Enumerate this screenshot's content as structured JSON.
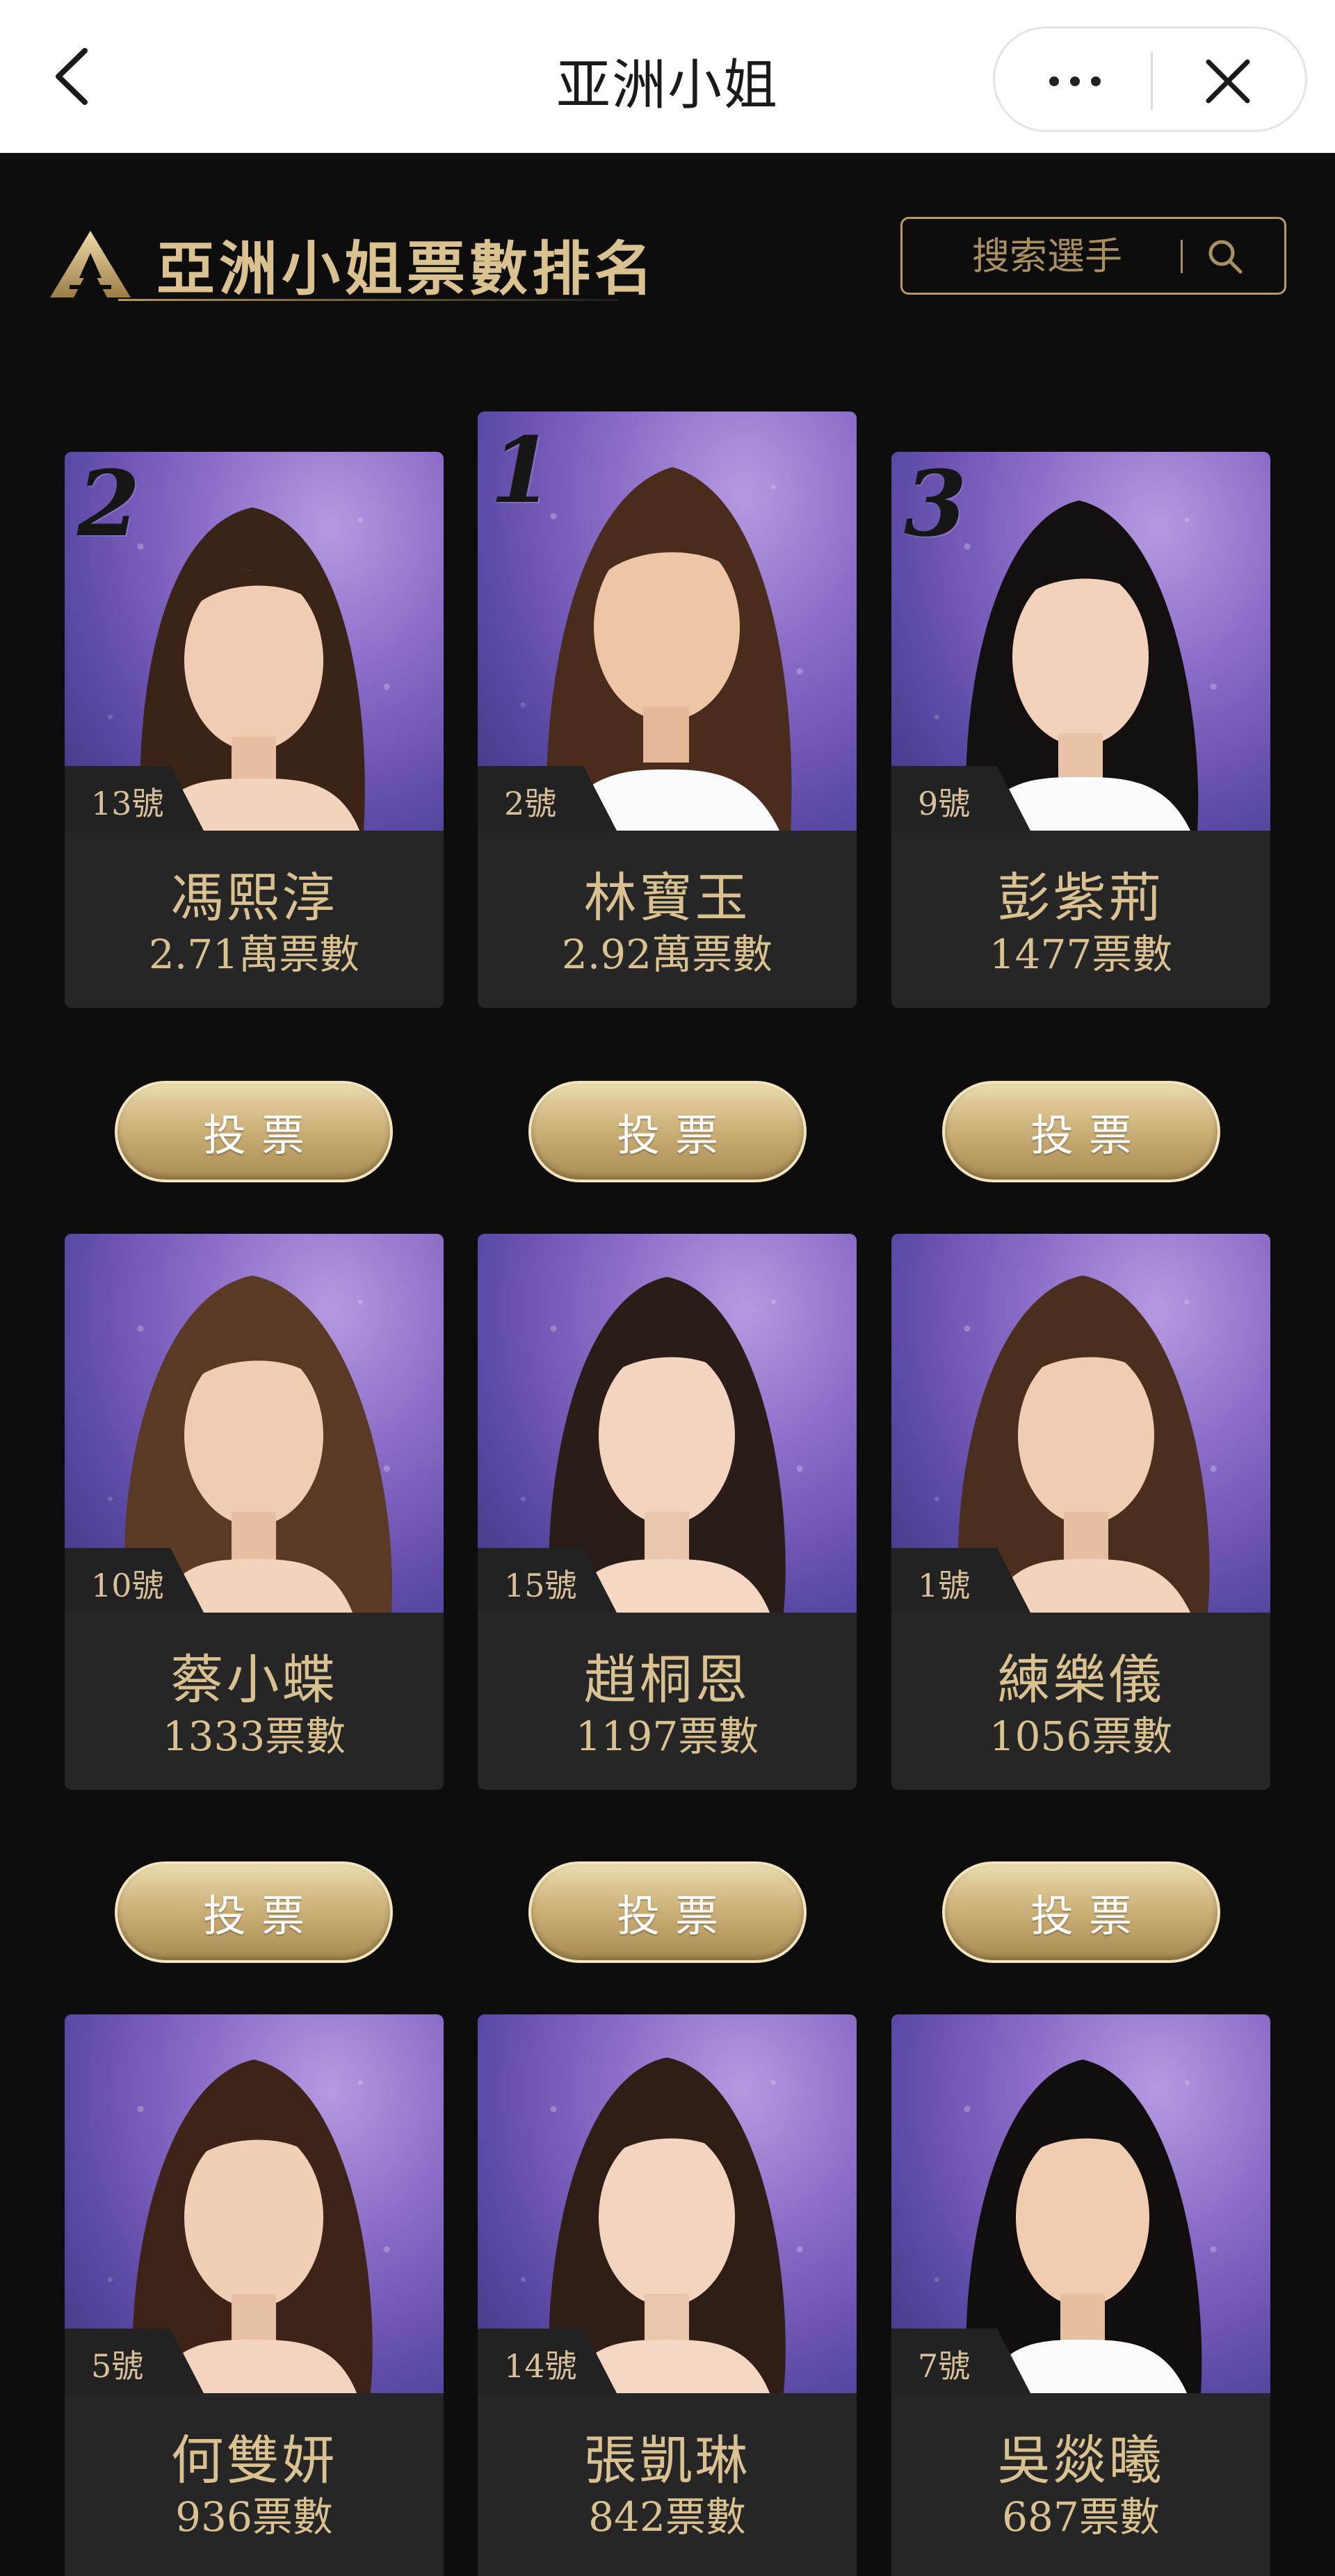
{
  "nav": {
    "title": "亚洲小姐"
  },
  "header": {
    "title": "亞洲小姐票數排名",
    "search_placeholder": "搜索選手"
  },
  "vote_label": "投票",
  "colors": {
    "gold": "#d9c190",
    "background": "#0d0d0d",
    "card": "#262626"
  },
  "contestants": [
    {
      "rank": "2",
      "number": "13號",
      "name": "馮熙淳",
      "votes": "2.71萬票數",
      "hair": "#3a2418"
    },
    {
      "rank": "1",
      "number": "2號",
      "name": "林寶玉",
      "votes": "2.92萬票數",
      "hair": "#4a2c1c"
    },
    {
      "rank": "3",
      "number": "9號",
      "name": "彭紫荊",
      "votes": "1477票數",
      "hair": "#141010"
    },
    {
      "rank": "",
      "number": "10號",
      "name": "蔡小蝶",
      "votes": "1333票數",
      "hair": "#5a3a24"
    },
    {
      "rank": "",
      "number": "15號",
      "name": "趙桐恩",
      "votes": "1197票數",
      "hair": "#2a1c16"
    },
    {
      "rank": "",
      "number": "1號",
      "name": "練樂儀",
      "votes": "1056票數",
      "hair": "#4a2e1e"
    },
    {
      "rank": "",
      "number": "5號",
      "name": "何雙妍",
      "votes": "936票數",
      "hair": "#3e2418"
    },
    {
      "rank": "",
      "number": "14號",
      "name": "張凱琳",
      "votes": "842票數",
      "hair": "#2e1e16"
    },
    {
      "rank": "",
      "number": "7號",
      "name": "吳燚曦",
      "votes": "687票數",
      "hair": "#120e0e"
    }
  ]
}
